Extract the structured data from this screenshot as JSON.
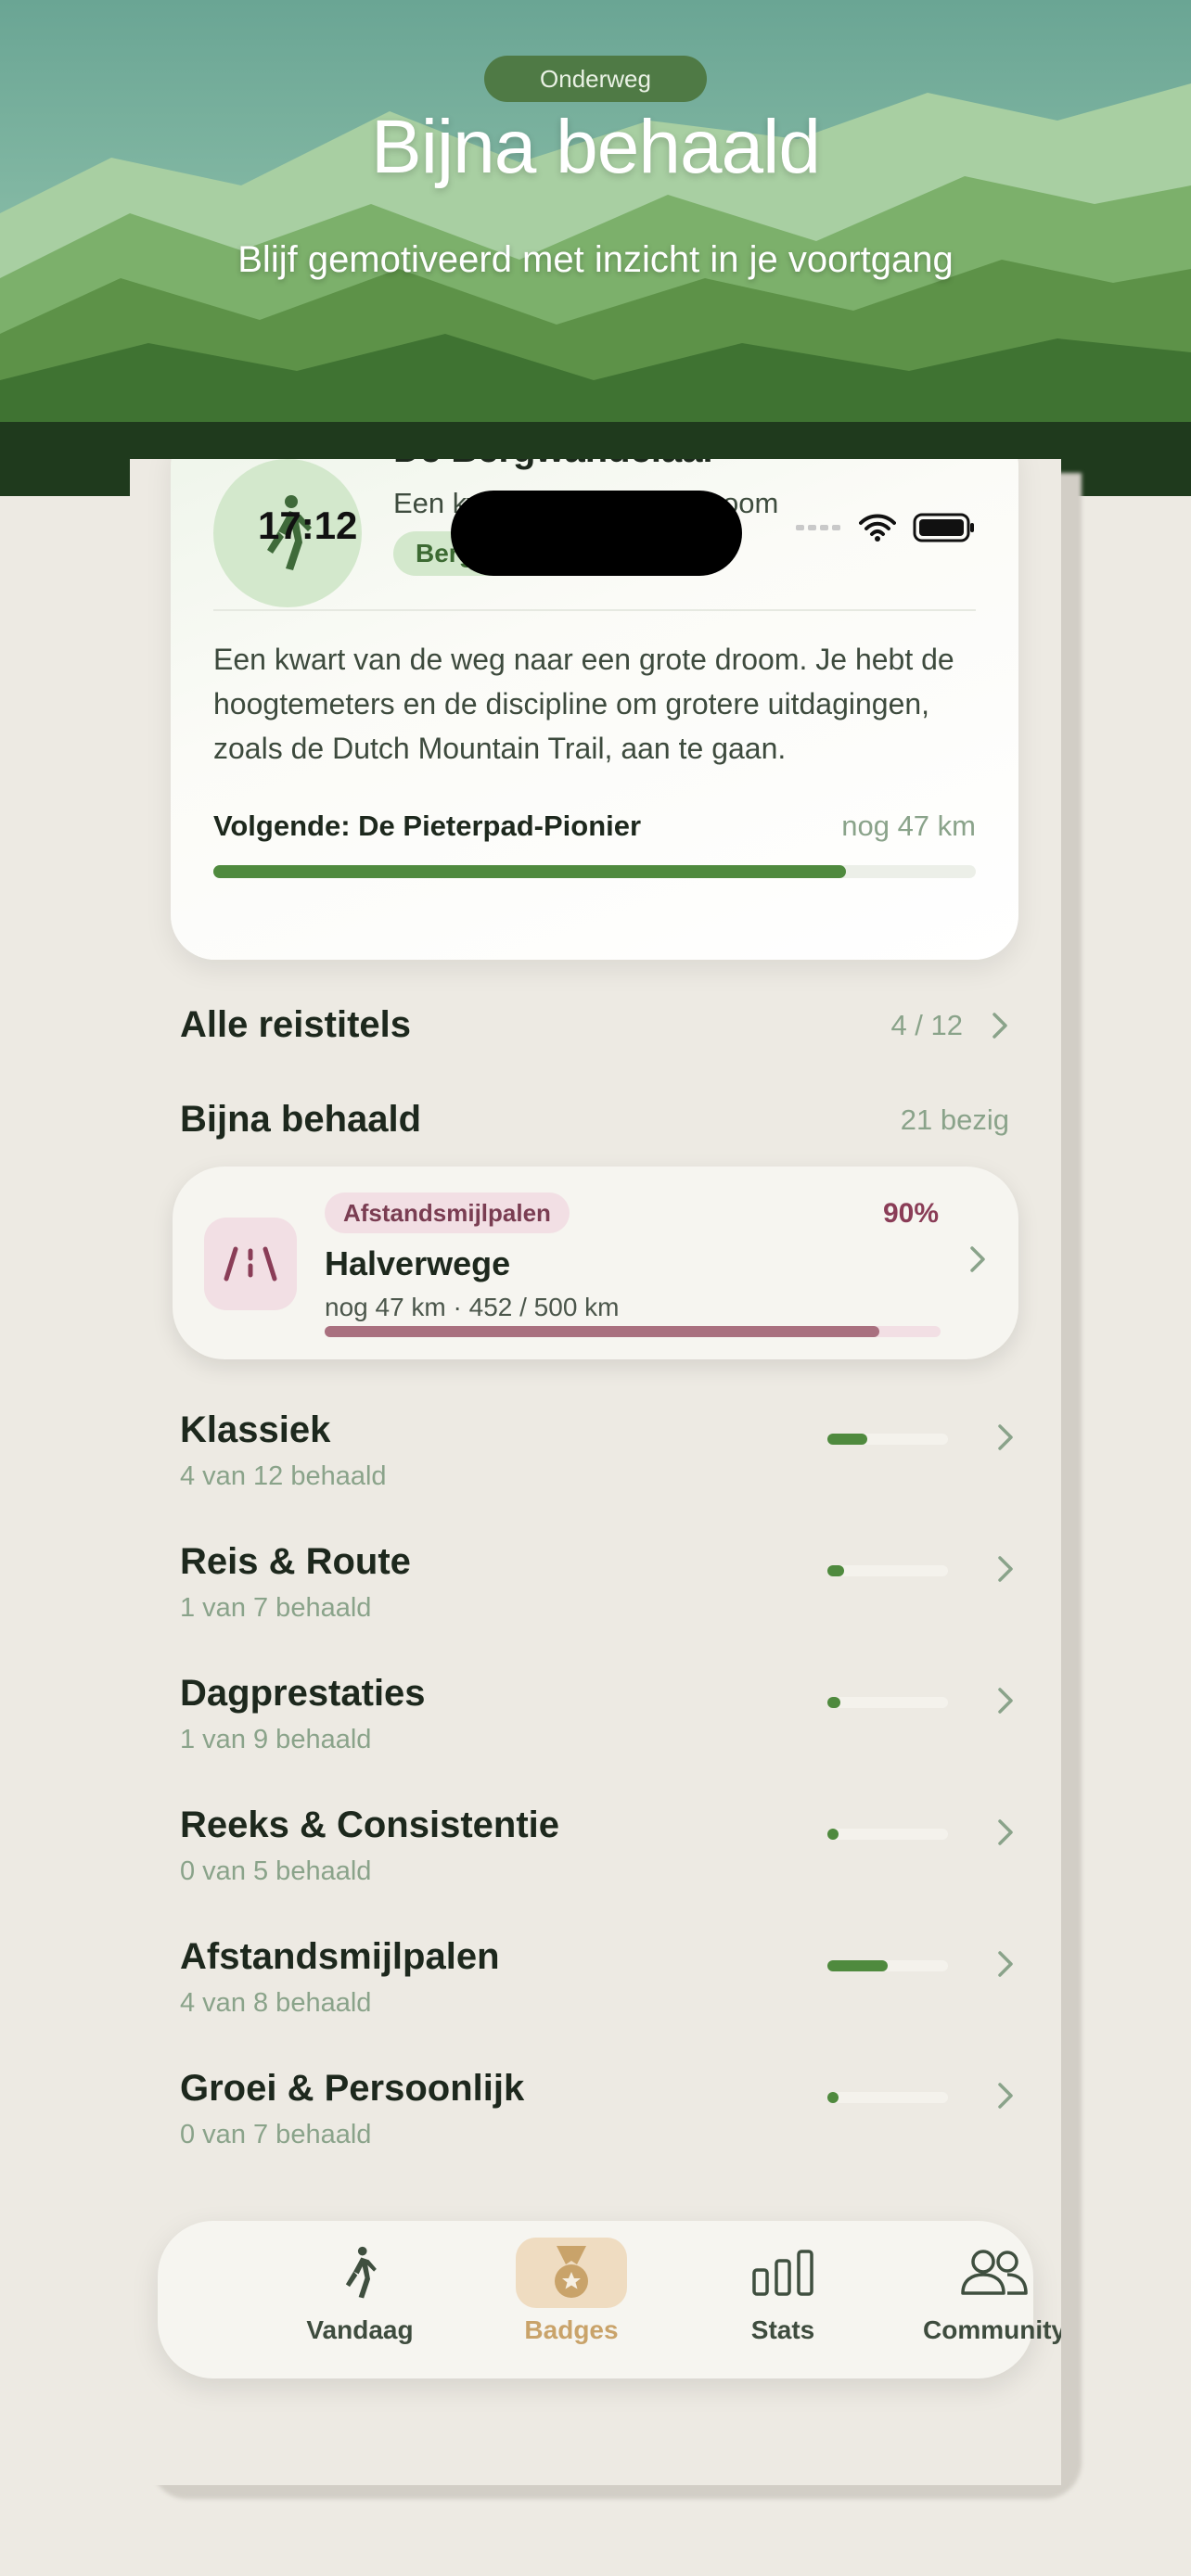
{
  "hero": {
    "pill": "Onderweg",
    "title": "Bijna behaald",
    "subtitle": "Blijf gemotiveerd met inzicht in je voortgang"
  },
  "status_bar": {
    "time": "17:12"
  },
  "level_card": {
    "title": "De Bergwandelaar",
    "subtitle": "Een kwart van de grote droom",
    "chip": "Berg-Wandelaar",
    "description": "Een kwart van de weg naar een grote droom. Je hebt de hoogtemeters en de discipline om grotere uitdagingen, zoals de Dutch Mountain Trail, aan te gaan.",
    "next_label": "Volgende: De Pieterpad-Pionier",
    "next_remaining": "nog 47 km",
    "next_progress": 0.83
  },
  "all_titles": {
    "label": "Alle reistitels",
    "count": "4 / 12"
  },
  "near_section": {
    "label": "Bijna behaald",
    "meta": "21 bezig"
  },
  "near_card": {
    "category": "Afstandsmijlpalen",
    "percent": "90%",
    "title": "Halverwege",
    "detail": "nog 47 km · 452 / 500 km",
    "progress": 0.9,
    "icon": "road-icon"
  },
  "categories": [
    {
      "name": "Klassiek",
      "count": "4 van 12 behaald",
      "progress": 0.33
    },
    {
      "name": "Reis & Route",
      "count": "1 van 7 behaald",
      "progress": 0.14
    },
    {
      "name": "Dagprestaties",
      "count": "1 van 9 behaald",
      "progress": 0.11
    },
    {
      "name": "Reeks & Consistentie",
      "count": "0 van 5 behaald",
      "progress": 0.0
    },
    {
      "name": "Afstandsmijlpalen",
      "count": "4 van 8 behaald",
      "progress": 0.5
    },
    {
      "name": "Groei & Persoonlijk",
      "count": "0 van 7 behaald",
      "progress": 0.0
    }
  ],
  "tabs": [
    {
      "label": "Vandaag",
      "icon": "walker-icon",
      "active": false
    },
    {
      "label": "Badges",
      "icon": "medal-icon",
      "active": true
    },
    {
      "label": "Stats",
      "icon": "bar-chart-icon",
      "active": false
    },
    {
      "label": "Community",
      "icon": "people-icon",
      "active": false
    }
  ],
  "colors": {
    "accent_green": "#4f8a3e",
    "badge_accent": "#c9a36a",
    "milestone_pink": "#a9707f",
    "background": "#edeae3"
  }
}
